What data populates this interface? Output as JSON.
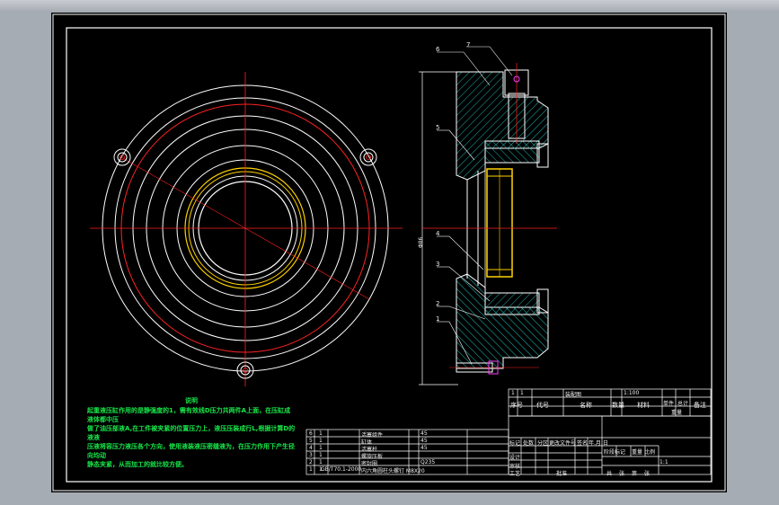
{
  "window": {
    "background": "#a6acb4",
    "sheet_color": "#000000"
  },
  "colors": {
    "outline": "#ffffff",
    "center_line": "#ff2222",
    "bolt_circle": "#ff2222",
    "bore": "#ffd200",
    "hatch": "#1fb5b5",
    "text_note": "#17e84a"
  },
  "notes": {
    "title": "说明",
    "lines": [
      "起重液压缸作用的是静强度的1，需有效线D压力共两件A上面，在压缸成液体都中压",
      "做了油压部液A,在工件被夹紧的位置压力上，液压压装成行L,根据计算D的液液",
      "压液将容压力液压各个方向，使用液装液压密缝液为，在压力作用下产生径向均动",
      "静态夹紧，从而加工的就比较方便。"
    ]
  },
  "balloons": [
    "6",
    "7",
    "5",
    "4",
    "3",
    "2",
    "1"
  ],
  "dimension_label": "Φ86",
  "parts_list": [
    {
      "no": "6",
      "qty": "1",
      "name": "活塞组件",
      "material": "45",
      "note": ""
    },
    {
      "no": "5",
      "qty": "1",
      "name": "缸体",
      "material": "45",
      "note": ""
    },
    {
      "no": "4",
      "qty": "1",
      "name": "活塞杆",
      "material": "45",
      "note": ""
    },
    {
      "no": "3",
      "qty": "1",
      "name": "螺旋压板",
      "material": "",
      "note": ""
    },
    {
      "no": "2",
      "qty": "1",
      "name": "密封圈",
      "material": "Q235",
      "note": ""
    },
    {
      "no": "1",
      "qty": "1",
      "name": "GB/T70.1-2000",
      "material": "",
      "note": "内六角圆柱头螺钉 M8X20"
    }
  ],
  "title_block": {
    "header_row": [
      "序号",
      "代号",
      "名称",
      "数量",
      "材料",
      "单件",
      "总计",
      "备注"
    ],
    "weight_label": "重量",
    "top_row": [
      "1",
      "1",
      "装配图",
      "",
      "1:100",
      "",
      ""
    ],
    "left_labels": [
      "标记",
      "处数",
      "分区",
      "更改文件号",
      "签名",
      "年.月.日"
    ],
    "sign_rows": [
      "设计",
      "审核",
      "工艺"
    ],
    "stage_labels": [
      "阶段标记",
      "重量",
      "比例"
    ],
    "sheet_labels": [
      "共",
      "张",
      "第",
      "张"
    ],
    "approve": "批准",
    "sheet_code": "1:1"
  }
}
